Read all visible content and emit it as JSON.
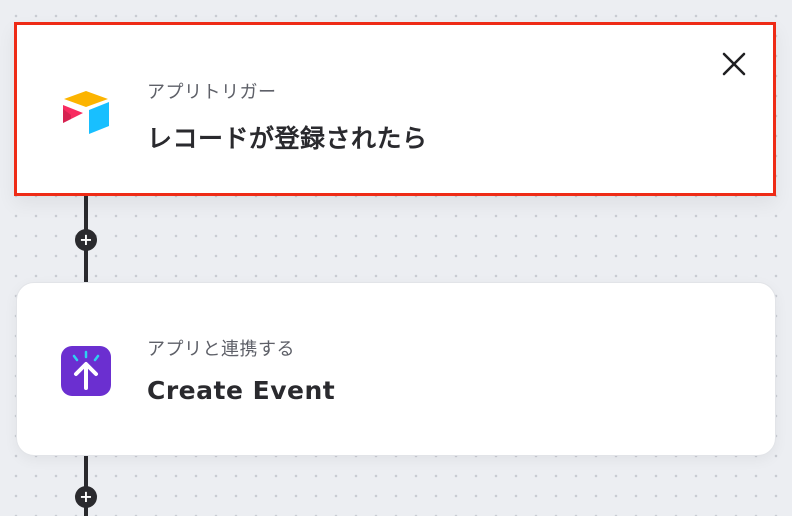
{
  "trigger_step": {
    "subtitle": "アプリトリガー",
    "title": "レコードが登録されたら",
    "app_icon": "airtable-icon",
    "close_icon": "close-icon",
    "highlight_color": "#ee2b16"
  },
  "action_step": {
    "subtitle": "アプリと連携する",
    "title": "Create Event",
    "app_icon": "upload-app-icon",
    "accent_color": "#6b2fd0"
  },
  "add_step_buttons": [
    {
      "label": "+",
      "icon": "plus-icon"
    },
    {
      "label": "+",
      "icon": "plus-icon"
    }
  ]
}
